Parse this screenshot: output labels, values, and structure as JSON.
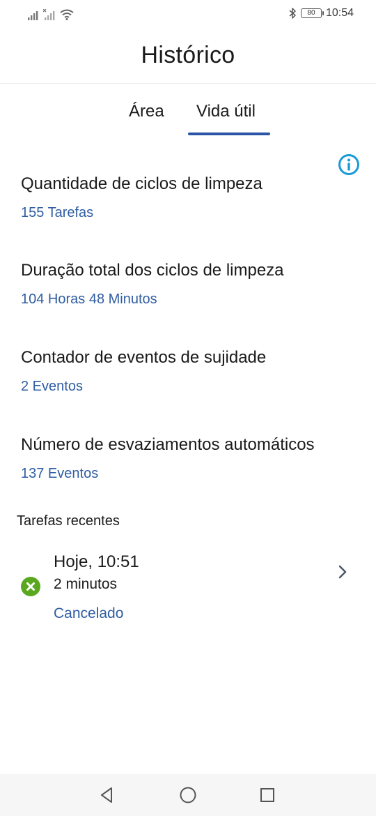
{
  "status_bar": {
    "time": "10:54",
    "battery": "80",
    "icons": [
      "signal-icon",
      "signal-icon",
      "wifi-icon",
      "bluetooth-icon",
      "battery-icon"
    ]
  },
  "header": {
    "title": "Histórico"
  },
  "tabs": [
    {
      "label": "Área",
      "active": false
    },
    {
      "label": "Vida útil",
      "active": true
    }
  ],
  "stats": [
    {
      "label": "Quantidade de ciclos de limpeza",
      "value": "155 Tarefas"
    },
    {
      "label": "Duração total dos ciclos de limpeza",
      "value": "104 Horas 48 Minutos"
    },
    {
      "label": "Contador de eventos de sujidade",
      "value": "2 Eventos"
    },
    {
      "label": "Número de esvaziamentos automáticos",
      "value": "137 Eventos"
    }
  ],
  "recent": {
    "title": "Tarefas recentes",
    "tasks": [
      {
        "date": "Hoje, 10:51",
        "duration": "2 minutos",
        "status": "Cancelado",
        "status_icon": "cancelled-icon"
      }
    ]
  },
  "colors": {
    "accent": "#2b56a6",
    "value_text": "#2f5da2",
    "info_icon": "#1a9ad6",
    "cancelled_badge": "#5aa81e"
  }
}
